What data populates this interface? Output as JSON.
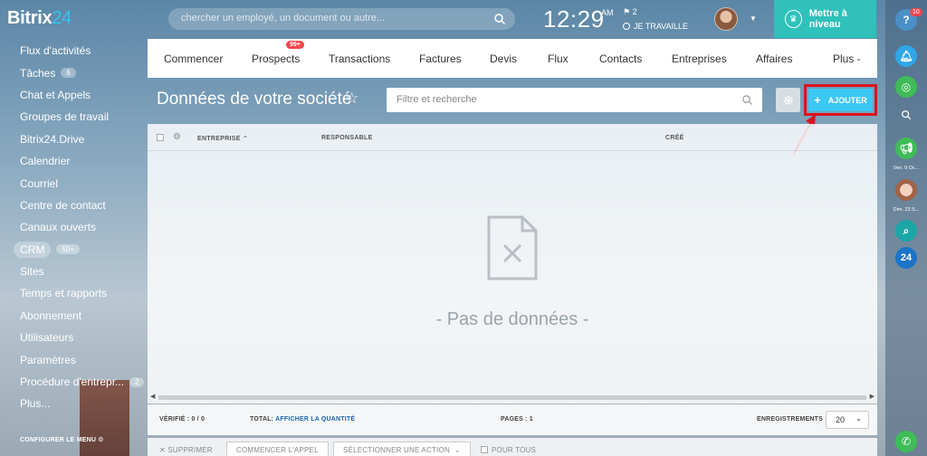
{
  "header": {
    "logo_text": "Bitrix",
    "logo_number": "24",
    "search_placeholder": "chercher un employé, un document ou autre...",
    "clock": "12:29",
    "ampm": "AM",
    "flag_count": "2",
    "work_status": "JE TRAVAILLE",
    "upgrade_label": "Mettre à niveau"
  },
  "sidebar": {
    "items": [
      {
        "label": "Flux d'activités"
      },
      {
        "label": "Tâches",
        "badge": "6"
      },
      {
        "label": "Chat et Appels"
      },
      {
        "label": "Groupes de travail"
      },
      {
        "label": "Bitrix24.Drive"
      },
      {
        "label": "Calendrier"
      },
      {
        "label": "Courriel"
      },
      {
        "label": "Centre de contact"
      },
      {
        "label": "Canaux ouverts"
      },
      {
        "label": "CRM",
        "badge": "50+",
        "active": true
      },
      {
        "label": "Sites"
      },
      {
        "label": "Temps et rapports"
      },
      {
        "label": "Abonnement"
      },
      {
        "label": "Utilisateurs"
      },
      {
        "label": "Paramètres"
      },
      {
        "label": "Procédure d'entrepr...",
        "badge": "2"
      },
      {
        "label": "Plus..."
      }
    ],
    "footer_label": "CONFIGURER LE MENU"
  },
  "crm_nav": {
    "items": [
      {
        "label": "Commencer"
      },
      {
        "label": "Prospects",
        "badge": "99+"
      },
      {
        "label": "Transactions"
      },
      {
        "label": "Factures"
      },
      {
        "label": "Devis"
      },
      {
        "label": "Flux"
      },
      {
        "label": "Contacts"
      },
      {
        "label": "Entreprises"
      },
      {
        "label": "Affaires"
      },
      {
        "label": "Plus -"
      }
    ]
  },
  "page": {
    "title": "Données de votre société",
    "filter_placeholder": "Filtre et recherche",
    "add_label": "AJOUTER"
  },
  "grid": {
    "columns": [
      "ENTREPRISE",
      "RESPONSABLE",
      "CRÉÉ"
    ],
    "empty_text": "- Pas de données -"
  },
  "footer": {
    "verified_label": "VÉRIFIÉ : 0 / 0",
    "total_label": "TOTAL:",
    "total_link": "AFFICHER LA QUANTITÉ",
    "pages_label": "PAGES : 1",
    "records_label": "ENREGISTREMENTS :",
    "page_size": "20"
  },
  "actions": {
    "delete": "SUPPRIMER",
    "start_call": "COMMENCER L'APPEL",
    "select_action": "SÉLECTIONNER UNE ACTION",
    "for_all": "POUR TOUS"
  },
  "right_bar": {
    "help_badge": "10",
    "label_1": "Ven. 9 Oc...",
    "label_2": "Dim. 23 S..."
  },
  "colors": {
    "accent": "#3bc8f5",
    "upgrade": "#2fc1ba",
    "highlight": "#d9131f",
    "badge": "#f1484c"
  }
}
